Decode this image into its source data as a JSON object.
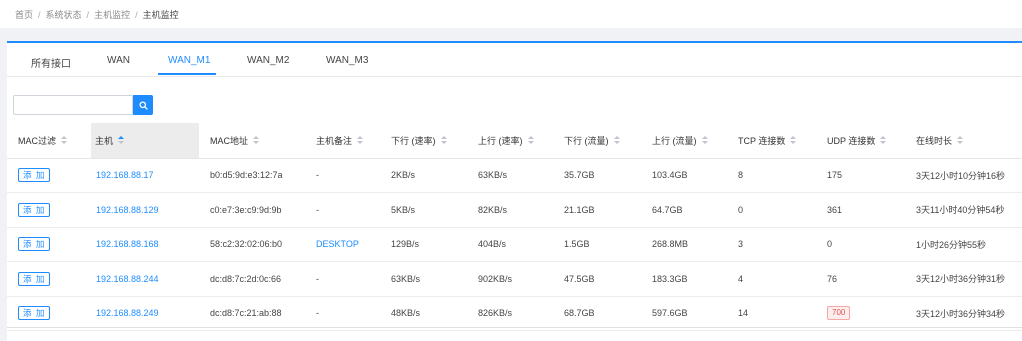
{
  "breadcrumb": [
    "首页",
    "系统状态",
    "主机监控",
    "主机监控"
  ],
  "tabs": [
    "所有接口",
    "WAN",
    "WAN_M1",
    "WAN_M2",
    "WAN_M3"
  ],
  "active_tab": "WAN_M1",
  "search": {
    "value": "",
    "icon": "search-icon"
  },
  "table": {
    "columns": [
      "MAC过滤",
      "主机",
      "MAC地址",
      "主机备注",
      "下行 (速率)",
      "上行 (速率)",
      "下行 (流量)",
      "上行 (流量)",
      "TCP 连接数",
      "UDP 连接数",
      "在线时长"
    ],
    "sorted_column": "主机",
    "sort_direction": "ascending",
    "rows": [
      {
        "action": "添 加",
        "host": "192.168.88.17",
        "mac": "b0:d5:9d:e3:12:7a",
        "note": "-",
        "down_rate": "2KB/s",
        "up_rate": "63KB/s",
        "down_traffic": "35.7GB",
        "up_traffic": "103.4GB",
        "tcp": "8",
        "udp": "175",
        "online": "3天12小时10分钟16秒"
      },
      {
        "action": "添 加",
        "host": "192.168.88.129",
        "mac": "c0:e7:3e:c9:9d:9b",
        "note": "-",
        "down_rate": "5KB/s",
        "up_rate": "82KB/s",
        "down_traffic": "21.1GB",
        "up_traffic": "64.7GB",
        "tcp": "0",
        "udp": "361",
        "online": "3天11小时40分钟54秒"
      },
      {
        "action": "添 加",
        "host": "192.168.88.168",
        "mac": "58:c2:32:02:06:b0",
        "note": "DESKTOP",
        "down_rate": "129B/s",
        "up_rate": "404B/s",
        "down_traffic": "1.5GB",
        "up_traffic": "268.8MB",
        "tcp": "3",
        "udp": "0",
        "online": "1小时26分钟55秒"
      },
      {
        "action": "添 加",
        "host": "192.168.88.244",
        "mac": "dc:d8:7c:2d:0c:66",
        "note": "-",
        "down_rate": "63KB/s",
        "up_rate": "902KB/s",
        "down_traffic": "47.5GB",
        "up_traffic": "183.3GB",
        "tcp": "4",
        "udp": "76",
        "online": "3天12小时36分钟31秒"
      },
      {
        "action": "添 加",
        "host": "192.168.88.249",
        "mac": "dc:d8:7c:21:ab:88",
        "note": "-",
        "down_rate": "48KB/s",
        "up_rate": "826KB/s",
        "down_traffic": "68.7GB",
        "up_traffic": "597.6GB",
        "tcp": "14",
        "udp": "700",
        "online": "3天12小时36分钟34秒"
      }
    ],
    "udp_warning_value": "700"
  },
  "colors": {
    "accent": "#1e8cff",
    "warning_text": "#e05555",
    "warning_bg": "#fdeeee"
  }
}
